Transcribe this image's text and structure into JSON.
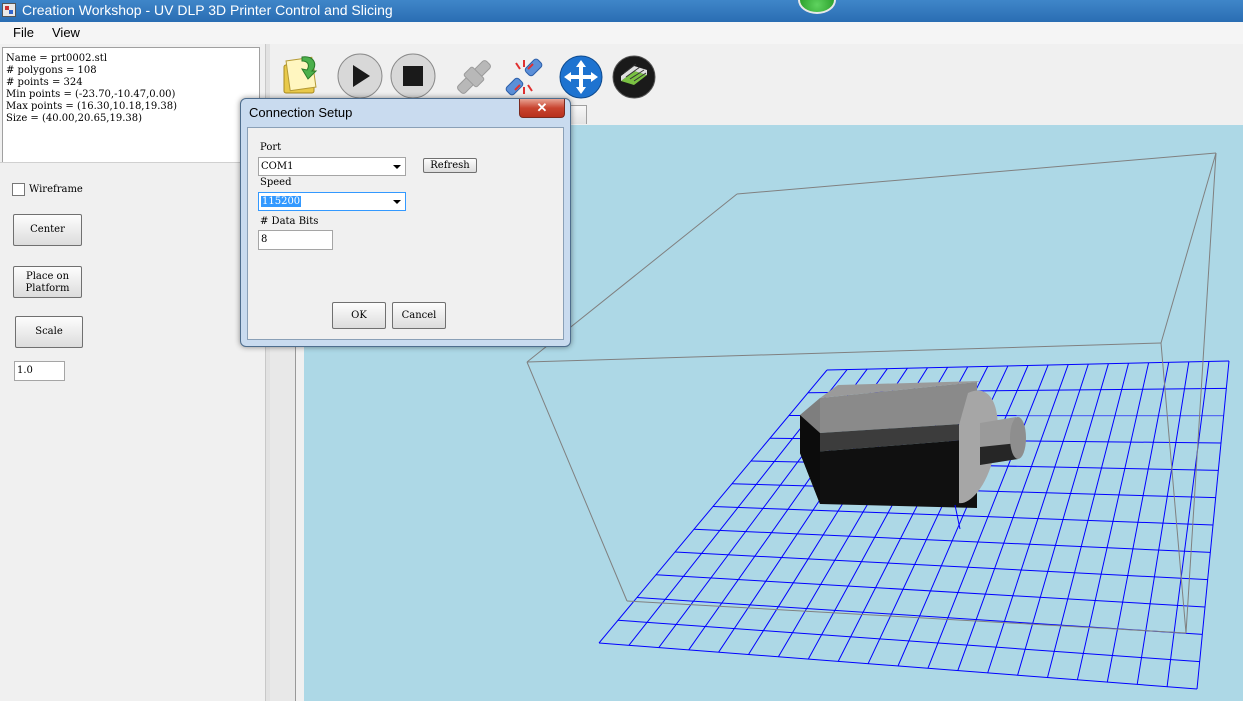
{
  "window": {
    "title": "Creation Workshop - UV DLP 3D Printer Control and Slicing"
  },
  "menu": {
    "file": "File",
    "view": "View"
  },
  "model_info": {
    "lines": [
      "Name = prt0002.stl",
      "# polygons = 108",
      "# points = 324",
      "Min points = (-23.70,-10.47,0.00)",
      "Max points = (16.30,10.18,19.38)",
      "Size = (40.00,20.65,19.38)"
    ]
  },
  "controls": {
    "wireframe_label": "Wireframe",
    "wireframe_checked": false,
    "center_label": "Center",
    "place_line1": "Place on",
    "place_line2": "Platform",
    "scale_label": "Scale",
    "scale_value": "1.0"
  },
  "toolbar": {
    "icons": [
      "open-file-icon",
      "play-icon",
      "stop-icon",
      "connect-icon",
      "disconnect-icon",
      "move-icon",
      "slice-icon"
    ]
  },
  "dialog": {
    "title": "Connection Setup",
    "close_glyph": "✕",
    "port_label": "Port",
    "port_value": "COM1",
    "refresh_label": "Refresh",
    "speed_label": "Speed",
    "speed_value": "115200",
    "databits_label": "# Data Bits",
    "databits_value": "8",
    "ok_label": "OK",
    "cancel_label": "Cancel"
  },
  "colors": {
    "viewport_bg": "#add8e6",
    "grid": "#0000ff",
    "build_volume": "#808080",
    "title_bar": "#3276bf"
  }
}
